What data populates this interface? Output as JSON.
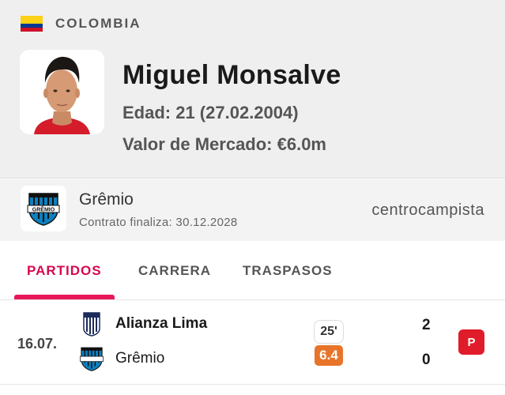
{
  "player": {
    "country": "COLOMBIA",
    "name": "Miguel Monsalve",
    "age": "Edad: 21 (27.02.2004)",
    "market_value": "Valor de Mercado: €6.0m",
    "photo_icon": "player-photo"
  },
  "club": {
    "name": "Grêmio",
    "contract": "Contrato finaliza: 30.12.2028",
    "position": "centrocampista",
    "logo_icon": "gremio-crest-icon"
  },
  "tabs": [
    {
      "label": "PARTIDOS",
      "active": true
    },
    {
      "label": "CARRERA",
      "active": false
    },
    {
      "label": "TRASPASOS",
      "active": false
    }
  ],
  "match": {
    "date": "16.07.",
    "home_team": "Alianza Lima",
    "away_team": "Grêmio",
    "minutes": "25'",
    "rating": "6.4",
    "home_score": "2",
    "away_score": "0",
    "badge": "P"
  },
  "colors": {
    "accent": "#e8185a",
    "rating": "#e8742a",
    "badge": "#e01c2a"
  }
}
